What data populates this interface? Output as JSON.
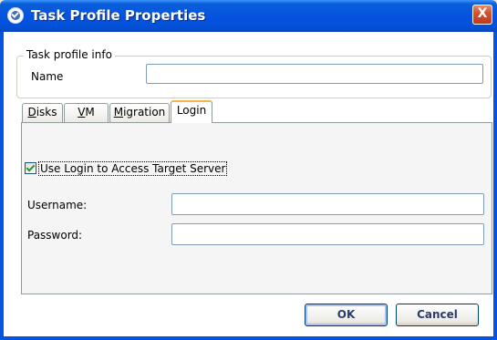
{
  "window": {
    "title": "Task Profile Properties",
    "close_glyph": "X"
  },
  "task_profile_info": {
    "legend": "Task profile info",
    "name_label": "Name",
    "name_value": ""
  },
  "tabs": [
    {
      "label": "Disks",
      "mnemonic": "D",
      "rest": "isks"
    },
    {
      "label": "VM",
      "mnemonic": "V",
      "rest": "M"
    },
    {
      "label": "Migration",
      "mnemonic": "M",
      "rest": "igration"
    },
    {
      "label": "Login",
      "mnemonic": "",
      "rest": "Login"
    }
  ],
  "active_tab": "Login",
  "login": {
    "use_login_label": "Use Login to Access Target Server",
    "use_login_checked": true,
    "username_label": "Username:",
    "username_value": "",
    "password_label": "Password:",
    "password_value": ""
  },
  "buttons": {
    "ok": "OK",
    "cancel": "Cancel"
  },
  "icons": {
    "title": "app-check-icon",
    "close": "close-icon",
    "checkbox": "checkmark-icon"
  },
  "colors": {
    "titlebar": "#0553e0",
    "close": "#c3391a",
    "active_tab_accent": "#f5b34a",
    "checkmark": "#21a121"
  }
}
